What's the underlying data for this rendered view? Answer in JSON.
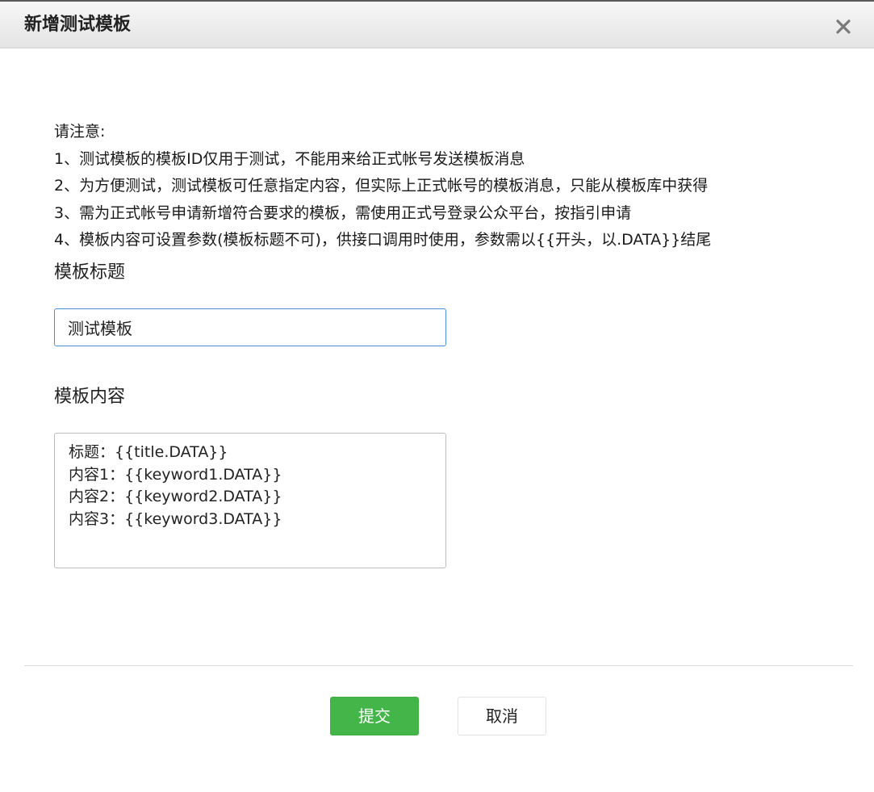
{
  "dialog": {
    "title": "新增测试模板",
    "close_icon": "close-icon"
  },
  "notice": {
    "heading": "请注意:",
    "items": [
      "1、测试模板的模板ID仅用于测试，不能用来给正式帐号发送模板消息",
      "2、为方便测试，测试模板可任意指定内容，但实际上正式帐号的模板消息，只能从模板库中获得",
      "3、需为正式帐号申请新增符合要求的模板，需使用正式号登录公众平台，按指引申请",
      "4、模板内容可设置参数(模板标题不可)，供接口调用时使用，参数需以{{开头，以.DATA}}结尾"
    ]
  },
  "form": {
    "title_label": "模板标题",
    "title_value": "测试模板",
    "content_label": "模板内容",
    "content_lines": [
      "标题：{{title.DATA}}",
      "内容1：{{keyword1.DATA}}",
      "内容2：{{keyword2.DATA}}",
      "内容3：{{keyword3.DATA}}"
    ]
  },
  "buttons": {
    "submit": "提交",
    "cancel": "取消"
  },
  "colors": {
    "submit_bg": "#44b549",
    "input_focus_border": "#4a90d9"
  }
}
